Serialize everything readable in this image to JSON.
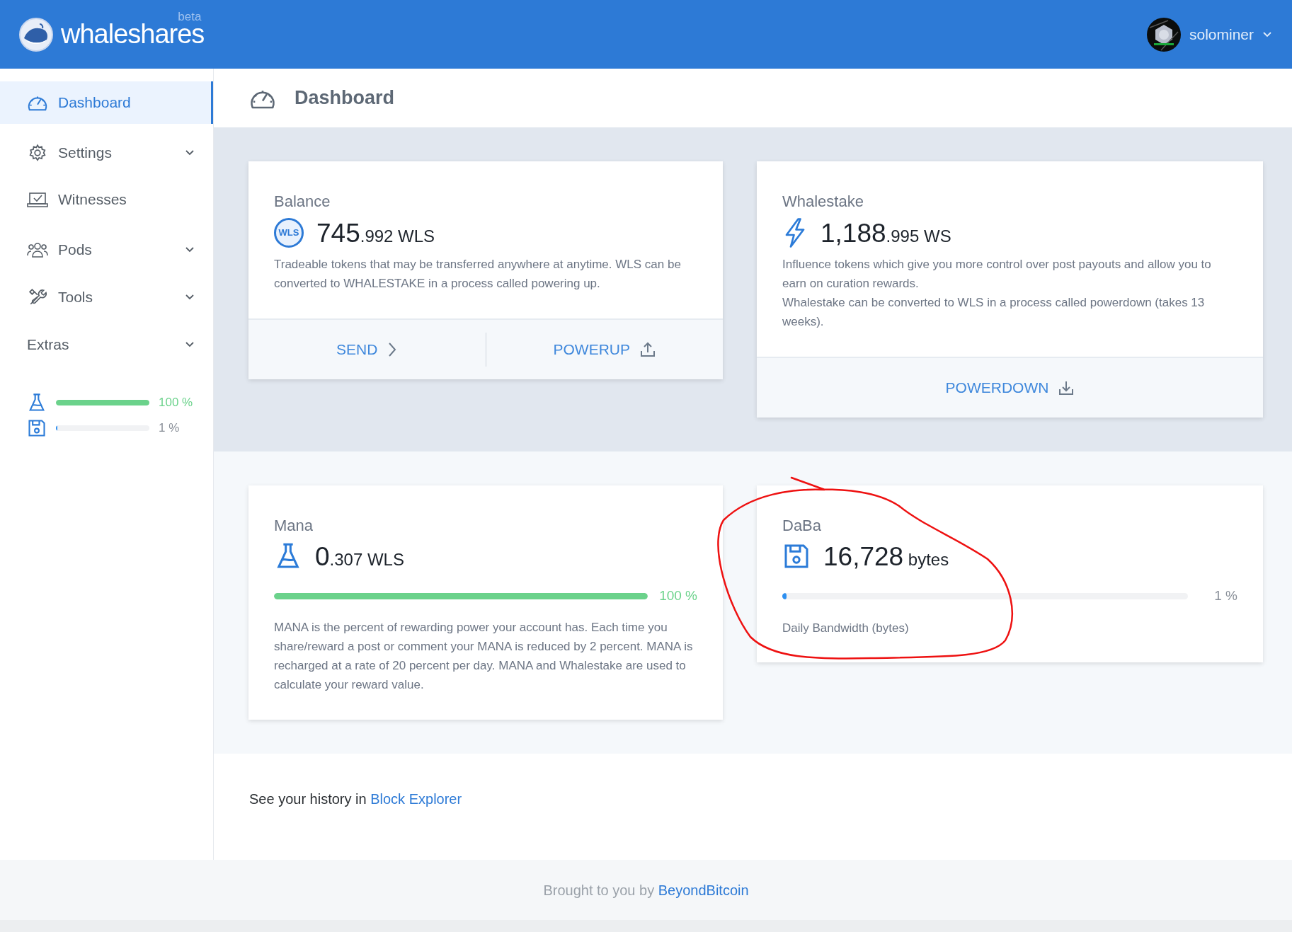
{
  "header": {
    "logo": "whaleshares",
    "badge": "beta",
    "user": "solominer"
  },
  "sidebar": {
    "items": [
      {
        "label": "Dashboard",
        "selected": true,
        "expandable": false
      },
      {
        "label": "Settings",
        "selected": false,
        "expandable": true
      },
      {
        "label": "Witnesses",
        "selected": false,
        "expandable": false
      },
      {
        "label": "Pods",
        "selected": false,
        "expandable": true
      },
      {
        "label": "Tools",
        "selected": false,
        "expandable": true
      },
      {
        "label": "Extras",
        "selected": false,
        "expandable": true
      }
    ],
    "meters": [
      {
        "kind": "mana",
        "level": 1,
        "reading": "100 %"
      },
      {
        "kind": "bandwidth",
        "level": 0.01,
        "reading": "1 %"
      }
    ]
  },
  "page_title": "Dashboard",
  "sections": [
    {
      "cards": [
        {
          "kind": "balance",
          "title": "Balance",
          "badge": "WLS",
          "whole": "745",
          "fraction": ".992",
          "unit": "WLS",
          "description": [
            "Tradeable tokens that may be transferred anywhere at anytime. WLS can be converted to WHALESTAKE in a process called powering up."
          ],
          "actions": [
            {
              "label": "SEND"
            },
            {
              "label": "POWERUP"
            }
          ]
        },
        {
          "kind": "whalestake",
          "title": "Whalestake",
          "whole": "1,188",
          "fraction": ".995",
          "unit": "WS",
          "description": [
            "Influence tokens which give you more control over post payouts and allow you to earn on curation rewards.",
            "Whalestake can be converted to WLS in a process called powerdown (takes 13 weeks)."
          ],
          "actions": [
            {
              "label": "POWERDOWN"
            }
          ]
        }
      ]
    },
    {
      "cards": [
        {
          "kind": "mana",
          "title": "Mana",
          "whole": "0",
          "fraction": ".307",
          "unit": "WLS",
          "meter": {
            "level": 1,
            "reading": "100 %"
          },
          "description": [
            "MANA is the percent of rewarding power your account has. Each time you share/reward a post or comment your MANA is reduced by 2 percent. MANA is recharged at a rate of 20 percent per day. MANA and Whalestake are used to calculate your reward value."
          ]
        },
        {
          "kind": "bandwidth",
          "title": "DaBa",
          "whole": "16,728",
          "unit": "bytes",
          "meter": {
            "level": 0.01,
            "reading": "1 %"
          },
          "caption": "Daily Bandwidth (bytes)"
        }
      ]
    }
  ],
  "history": {
    "text": "See your history in ",
    "link": "Block Explorer"
  },
  "footer": {
    "text": "Brought to you by ",
    "link": "BeyondBitcoin"
  }
}
